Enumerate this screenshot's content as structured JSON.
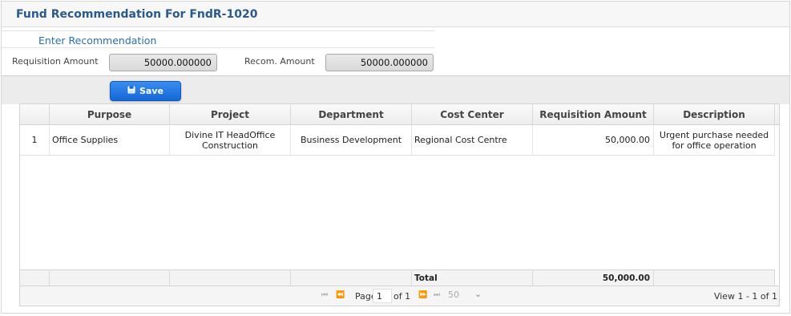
{
  "page": {
    "title": "Fund Recommendation For FndR-1020",
    "section_title": "Enter Recommendation"
  },
  "form": {
    "requisition_amount_label": "Requisition Amount",
    "requisition_amount_value": "50000.000000",
    "recom_amount_label": "Recom. Amount",
    "recom_amount_value": "50000.000000"
  },
  "toolbar": {
    "save_label": "Save"
  },
  "grid": {
    "headers": [
      "Purpose",
      "Project",
      "Department",
      "Cost Center",
      "Requisition Amount",
      "Description"
    ],
    "rows": [
      {
        "num": "1",
        "purpose": "Office Supplies",
        "project": "Divine IT HeadOffice Construction",
        "department": "Business Development",
        "cost_center": "Regional Cost Centre",
        "requisition_amount": "50,000.00",
        "description": "Urgent purchase needed for office operation"
      }
    ],
    "footer": {
      "total_label": "Total",
      "total_value": "50,000.00"
    }
  },
  "pager": {
    "page_label": "Page",
    "page_value": "1",
    "of_label": "of 1",
    "rows_per_page": "50",
    "view_text": "View 1 - 1 of 1"
  },
  "colors": {
    "title": "#2a5a8c",
    "accent": "#1467d6",
    "section": "#2a6fb5"
  },
  "icons": {
    "save": "floppy-disk-icon",
    "first": "first-page-icon",
    "prev": "prev-page-icon",
    "next": "next-page-icon",
    "last": "last-page-icon",
    "dropdown": "chevron-down-icon"
  }
}
